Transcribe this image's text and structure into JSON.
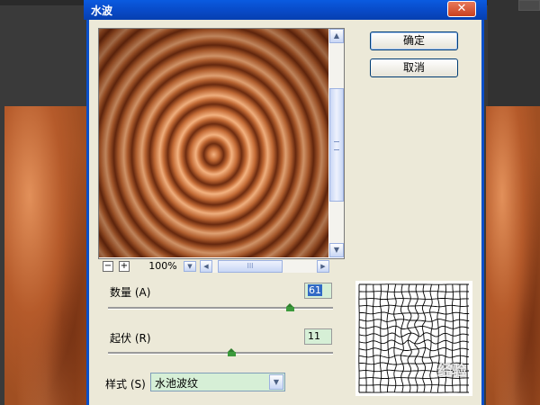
{
  "window": {
    "title": "水波",
    "close_glyph": "✕"
  },
  "buttons": {
    "ok": "确定",
    "cancel": "取消"
  },
  "preview": {
    "zoom": "100%",
    "zoom_out": "−",
    "zoom_in": "+",
    "scroll_up": "▲",
    "scroll_down": "▼",
    "scroll_left": "◀",
    "scroll_right": "▶",
    "dropdown": "▼",
    "grip_glyph": "III"
  },
  "params": {
    "amount": {
      "label": "数量 (A)",
      "value": "61",
      "level_percent": 81
    },
    "ridges": {
      "label": "起伏 (R)",
      "value": "11",
      "level_percent": 55
    },
    "style": {
      "label": "样式 (S)",
      "value": "水池波纹"
    }
  },
  "watermark": "经验",
  "colors": {
    "title_blue": "#0848c4",
    "dialog_bg": "#ece9d8",
    "field_green": "#d6efd6",
    "copper": "#c46b35"
  },
  "icons": [
    "close-icon",
    "zoom-out-icon",
    "zoom-in-icon",
    "chevron-up-icon",
    "chevron-down-icon",
    "chevron-left-icon",
    "chevron-right-icon"
  ]
}
